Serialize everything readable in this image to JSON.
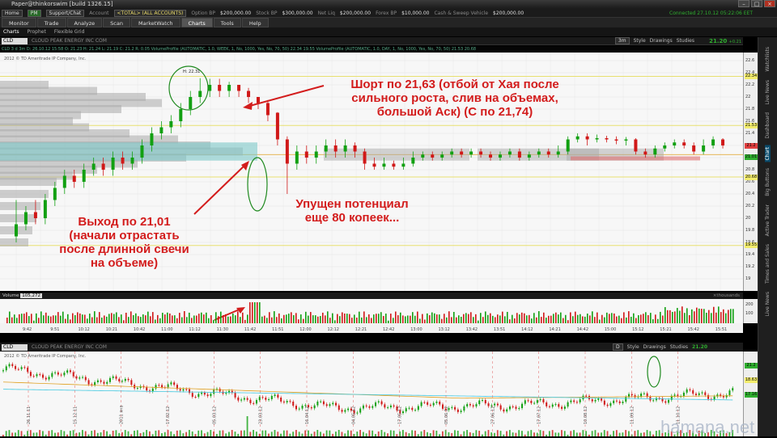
{
  "window": {
    "title": "Paper@thinkorswim [build 1326.15]"
  },
  "account_bar": {
    "home": "Home",
    "pm": "PM",
    "support": "Support/Chat",
    "account_label": "Account",
    "account_value": "<TOTAL> (ALL ACCOUNTS)",
    "option_bp_label": "Option BP",
    "option_bp_value": "$200,000.00",
    "stock_bp_label": "Stock BP",
    "stock_bp_value": "$300,000.00",
    "net_liq_label": "Net Liq",
    "net_liq_value": "$200,000.00",
    "forex_bp_label": "Forex BP",
    "forex_bp_value": "$10,000.00",
    "cash_label": "Cash & Sweep Vehicle",
    "cash_value": "$200,000.00",
    "connection": "Connected 27.10.12 05:22:06 EET"
  },
  "tabs": [
    "Monitor",
    "Trade",
    "Analyze",
    "Scan",
    "MarketWatch",
    "Charts",
    "Tools",
    "Help"
  ],
  "active_tab": "Charts",
  "subtabs": [
    "Charts",
    "Prophet",
    "Flexible Grid"
  ],
  "upper": {
    "symbol": "CLD",
    "company": "CLOUD PEAK ENERGY INC COM",
    "tools": [
      "Style",
      "Drawings",
      "Studies"
    ],
    "timeframe": "3m",
    "price": "21.20",
    "change": "+0.21",
    "study_text": "CLD 3 d 3m  D: 26.10.12 15:58  O: 21.23  H: 21.24  L: 21.19  C: 21.2  R: 0.05   VolumeProfile (AUTOMATIC, 1.0, WEEK, 1, No, 1000, Yes, No, 70, 50)  22.34  19.55   VolumeProfile (AUTOMATIC, 1.0, DAY, 1, No, 1000, Yes, No, 70, 50)  21.53  20.68",
    "copyright": "2012 © TD Ameritrade IP Company, Inc.",
    "high_marker": "H: 22.31",
    "price_tags": [
      "22.34",
      "21.53",
      "21.2",
      "21.01",
      "20.68",
      "19.55"
    ],
    "y_ticks": [
      "22.6",
      "22.4",
      "22.2",
      "22",
      "21.8",
      "21.6",
      "21.4",
      "21.2",
      "21",
      "20.8",
      "20.6",
      "20.4",
      "20.2",
      "20",
      "19.8",
      "19.6",
      "19.4",
      "19.2",
      "19"
    ]
  },
  "volume": {
    "label": "Volume",
    "value": "105,272",
    "units": "×thousands",
    "y_ticks": [
      "200",
      "100"
    ]
  },
  "time_ticks": [
    "9:42",
    "9:51",
    "10:12",
    "10:21",
    "10:42",
    "11:00",
    "11:12",
    "11:30",
    "11:42",
    "11:51",
    "12:00",
    "12:12",
    "12:21",
    "12:42",
    "13:00",
    "13:12",
    "13:42",
    "13:51",
    "14:12",
    "14:21",
    "14:42",
    "15:00",
    "15:12",
    "15:21",
    "15:42",
    "15:51"
  ],
  "lower": {
    "symbol": "CLD",
    "company": "CLOUD PEAK ENERGY INC COM",
    "timeframe": "D",
    "tools": [
      "Style",
      "Drawings",
      "Studies"
    ],
    "price": "21.20",
    "change": "+0.21",
    "copyright": "2012 © TD Ameritrade IP Company, Inc.",
    "price_tags": [
      "21.2",
      "18.63",
      "17.16"
    ],
    "date_ticks": [
      "26.11.11",
      "15.12.11",
      "2011 янв",
      "17.02.12",
      "05.03.12",
      "23.03.12",
      "16.04.12",
      "04.05.12",
      "17.05.12",
      "05.06.12",
      "27.06.12",
      "17.07.12",
      "10.08.12",
      "11.09.12",
      "11.10.12"
    ]
  },
  "sidebar": [
    "Watchlists",
    "Live News",
    "Dashboard",
    "Chart",
    "Big Buttons",
    "Active Trader",
    "Times and Sales",
    "Live News"
  ],
  "annotations": {
    "short": "Шорт по 21,63 (отбой от Хая после сильного роста, слив на объемах, большой Аск) (С по 21,74)",
    "exit": "Выход по 21,01 (начали отрастать после длинной свечи на объеме)",
    "missed": "Упущен потенциал еще 80 копеек..."
  },
  "watermark": "hamana.net",
  "colors": {
    "up": "#12a012",
    "down": "#d01818",
    "profile": "#a9a9a9",
    "value_area": "#7cc8c8",
    "annotation": "#d31c1c",
    "tag_yellow": "#f2ec6c",
    "tag_green": "#2fae2f",
    "tag_red": "#e04040"
  }
}
